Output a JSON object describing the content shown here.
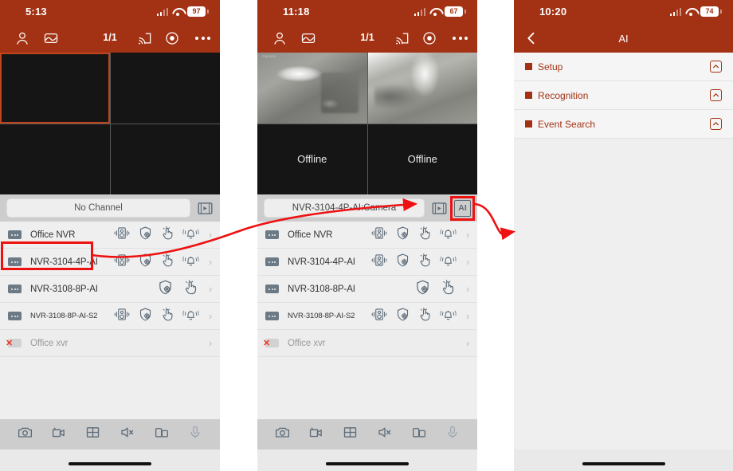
{
  "app": {
    "accent_orange": "#a33214",
    "highlight_red": "#ee1111",
    "panel_gray": "#efefef"
  },
  "phones": [
    {
      "id": "left",
      "status": {
        "time": "5:13",
        "battery": "97",
        "wifi_icon": "wifi-icon",
        "signal_icon": "signal-bars-icon"
      },
      "navbar": {
        "person_icon": "person-icon",
        "gallery_icon": "image-icon",
        "page_count": "1/1",
        "cast_icon": "cast-icon",
        "eye_icon": "eye-icon",
        "more_icon": "more-options-icon"
      },
      "grid": {
        "cells": [
          {
            "state": "selected-empty",
            "label": ""
          },
          {
            "state": "empty",
            "label": ""
          },
          {
            "state": "empty",
            "label": ""
          },
          {
            "state": "empty",
            "label": ""
          }
        ]
      },
      "channel_bar": {
        "value": "No Channel",
        "film_icon": "film-strip-icon",
        "ai_label": "AI",
        "ai_visible": false
      },
      "devices": [
        {
          "name": "Office NVR",
          "online": true,
          "size": "normal",
          "icons": [
            "intercom-icon",
            "shield-gear-icon",
            "hand-touch-icon",
            "bell-icon"
          ]
        },
        {
          "name": "NVR-3104-4P-AI",
          "online": true,
          "size": "normal",
          "icons": [
            "intercom-icon",
            "shield-gear-icon",
            "hand-touch-icon",
            "bell-icon"
          ],
          "highlighted": true
        },
        {
          "name": "NVR-3108-8P-AI",
          "online": true,
          "size": "normal",
          "icons": [
            "shield-gear-icon",
            "hand-touch-icon"
          ]
        },
        {
          "name": "NVR-3108-8P-AI-S2",
          "online": true,
          "size": "small",
          "icons": [
            "intercom-icon",
            "shield-gear-icon",
            "hand-touch-icon",
            "bell-icon"
          ]
        },
        {
          "name": "Office xvr",
          "online": false,
          "size": "normal",
          "icons": []
        }
      ],
      "toolbar": [
        {
          "icon": "snapshot-camera-icon"
        },
        {
          "icon": "record-video-icon"
        },
        {
          "icon": "grid-layout-icon"
        },
        {
          "icon": "mute-speaker-icon"
        },
        {
          "icon": "rotate-screen-icon"
        },
        {
          "icon": "microphone-icon"
        }
      ]
    },
    {
      "id": "mid",
      "status": {
        "time": "11:18",
        "battery": "67",
        "wifi_icon": "wifi-icon",
        "signal_icon": "signal-bars-icon"
      },
      "navbar": {
        "person_icon": "person-icon",
        "gallery_icon": "image-icon",
        "page_count": "1/1",
        "cast_icon": "cast-icon",
        "eye_icon": "eye-icon",
        "more_icon": "more-options-icon"
      },
      "grid": {
        "cells": [
          {
            "state": "selected-live",
            "label": "Camera"
          },
          {
            "state": "live",
            "label": ""
          },
          {
            "state": "offline",
            "label": "Offline"
          },
          {
            "state": "offline",
            "label": "Offline"
          }
        ]
      },
      "channel_bar": {
        "value": "NVR-3104-4P-AI:Camera",
        "film_icon": "film-strip-icon",
        "ai_label": "AI",
        "ai_visible": true,
        "ai_highlighted": true
      },
      "devices": [
        {
          "name": "Office NVR",
          "online": true,
          "size": "normal",
          "icons": [
            "intercom-icon",
            "shield-gear-icon",
            "hand-touch-icon",
            "bell-icon"
          ]
        },
        {
          "name": "NVR-3104-4P-AI",
          "online": true,
          "size": "normal",
          "icons": [
            "intercom-icon",
            "shield-gear-icon",
            "hand-touch-icon",
            "bell-icon"
          ]
        },
        {
          "name": "NVR-3108-8P-AI",
          "online": true,
          "size": "normal",
          "icons": [
            "shield-gear-icon",
            "hand-touch-icon"
          ]
        },
        {
          "name": "NVR-3108-8P-AI-S2",
          "online": true,
          "size": "small",
          "icons": [
            "intercom-icon",
            "shield-gear-icon",
            "hand-touch-icon",
            "bell-icon"
          ]
        },
        {
          "name": "Office xvr",
          "online": false,
          "size": "normal",
          "icons": []
        }
      ],
      "toolbar": [
        {
          "icon": "snapshot-camera-icon"
        },
        {
          "icon": "record-video-icon"
        },
        {
          "icon": "grid-layout-icon"
        },
        {
          "icon": "mute-speaker-icon"
        },
        {
          "icon": "rotate-screen-icon"
        },
        {
          "icon": "microphone-icon"
        }
      ]
    },
    {
      "id": "right",
      "status": {
        "time": "10:20",
        "battery": "74",
        "wifi_icon": "wifi-icon",
        "signal_icon": "signal-bars-icon"
      },
      "navbar": {
        "back_icon": "back-chevron-icon",
        "title": "AI"
      },
      "menu": [
        {
          "label": "Setup",
          "expander_icon": "chevron-up-boxed-icon"
        },
        {
          "label": "Recognition",
          "expander_icon": "chevron-up-boxed-icon"
        },
        {
          "label": "Event Search",
          "expander_icon": "chevron-up-boxed-icon"
        }
      ]
    }
  ],
  "annotations": {
    "arrow_1": "red-curved-arrow-left-to-mid",
    "arrow_2": "red-curved-arrow-mid-to-right",
    "box_device_row": "red-highlight-box-nvr-3104",
    "box_ai_button": "red-highlight-box-ai-button"
  }
}
